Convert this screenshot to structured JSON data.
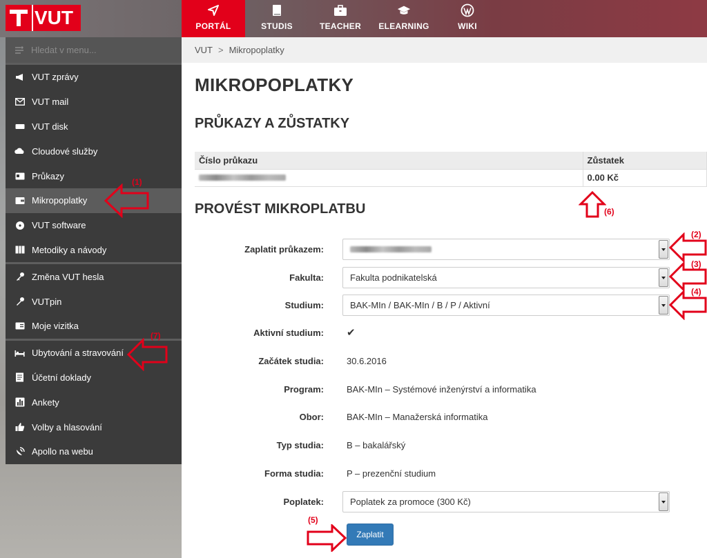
{
  "header": {
    "logo_text": "VUT",
    "nav": [
      {
        "label": "PORTÁL",
        "icon": "navigation-arrow-icon",
        "active": true
      },
      {
        "label": "STUDIS",
        "icon": "book-icon"
      },
      {
        "label": "TEACHER",
        "icon": "briefcase-icon"
      },
      {
        "label": "ELEARNING",
        "icon": "graduation-cap-icon"
      },
      {
        "label": "WIKI",
        "icon": "wordpress-icon"
      }
    ],
    "accent": "#e2001a"
  },
  "sidebar": {
    "search_placeholder": "Hledat v menu...",
    "items": [
      {
        "label": "VUT zprávy",
        "icon": "megaphone-icon"
      },
      {
        "label": "VUT mail",
        "icon": "envelope-icon"
      },
      {
        "label": "VUT disk",
        "icon": "drive-icon"
      },
      {
        "label": "Cloudové služby",
        "icon": "cloud-icon"
      },
      {
        "label": "Průkazy",
        "icon": "id-card-icon"
      },
      {
        "label": "Mikropoplatky",
        "icon": "wallet-icon",
        "active": true
      },
      {
        "label": "VUT software",
        "icon": "disc-icon"
      },
      {
        "label": "Metodiky a návody",
        "icon": "columns-icon"
      },
      {
        "label": "Změna VUT hesla",
        "icon": "key-icon"
      },
      {
        "label": "VUTpin",
        "icon": "pin-key-icon"
      },
      {
        "label": "Moje vizitka",
        "icon": "vcard-icon"
      },
      {
        "label": "Ubytování a stravování",
        "icon": "bed-icon"
      },
      {
        "label": "Účetní doklady",
        "icon": "document-icon"
      },
      {
        "label": "Ankety",
        "icon": "poll-icon"
      },
      {
        "label": "Volby a hlasování",
        "icon": "thumbs-up-icon"
      },
      {
        "label": "Apollo na webu",
        "icon": "satellite-icon"
      }
    ]
  },
  "breadcrumb": {
    "root": "VUT",
    "separator": ">",
    "current": "Mikropoplatky"
  },
  "page": {
    "title": "MIKROPOPLATKY",
    "cards_heading": "PRŮKAZY A ZŮSTATKY",
    "cards_table": {
      "headers": [
        "Číslo průkazu",
        "Zůstatek"
      ],
      "rows": [
        {
          "balance": "0.00 Kč"
        }
      ]
    },
    "pay_heading": "PROVÉST MIKROPLATBU"
  },
  "form": {
    "card_label": "Zaplatit průkazem:",
    "faculty_label": "Fakulta:",
    "faculty_value": "Fakulta podnikatelská",
    "study_label": "Studium:",
    "study_value": "BAK-MIn / BAK-MIn / B / P / Aktivní",
    "active_label": "Aktivní studium:",
    "active_value": "✔",
    "start_label": "Začátek studia:",
    "start_value": "30.6.2016",
    "program_label": "Program:",
    "program_value": "BAK-MIn – Systémové inženýrství a informatika",
    "field_label": "Obor:",
    "field_value": "BAK-MIn – Manažerská informatika",
    "type_label": "Typ studia:",
    "type_value": "B – bakalářský",
    "form_label": "Forma studia:",
    "form_value": "P – prezenční studium",
    "fee_label": "Poplatek:",
    "fee_value": "Poplatek za promoce (300 Kč)",
    "pay_button": "Zaplatit"
  },
  "annotations": [
    "(1)",
    "(2)",
    "(3)",
    "(4)",
    "(5)",
    "(6)",
    "(7)"
  ]
}
